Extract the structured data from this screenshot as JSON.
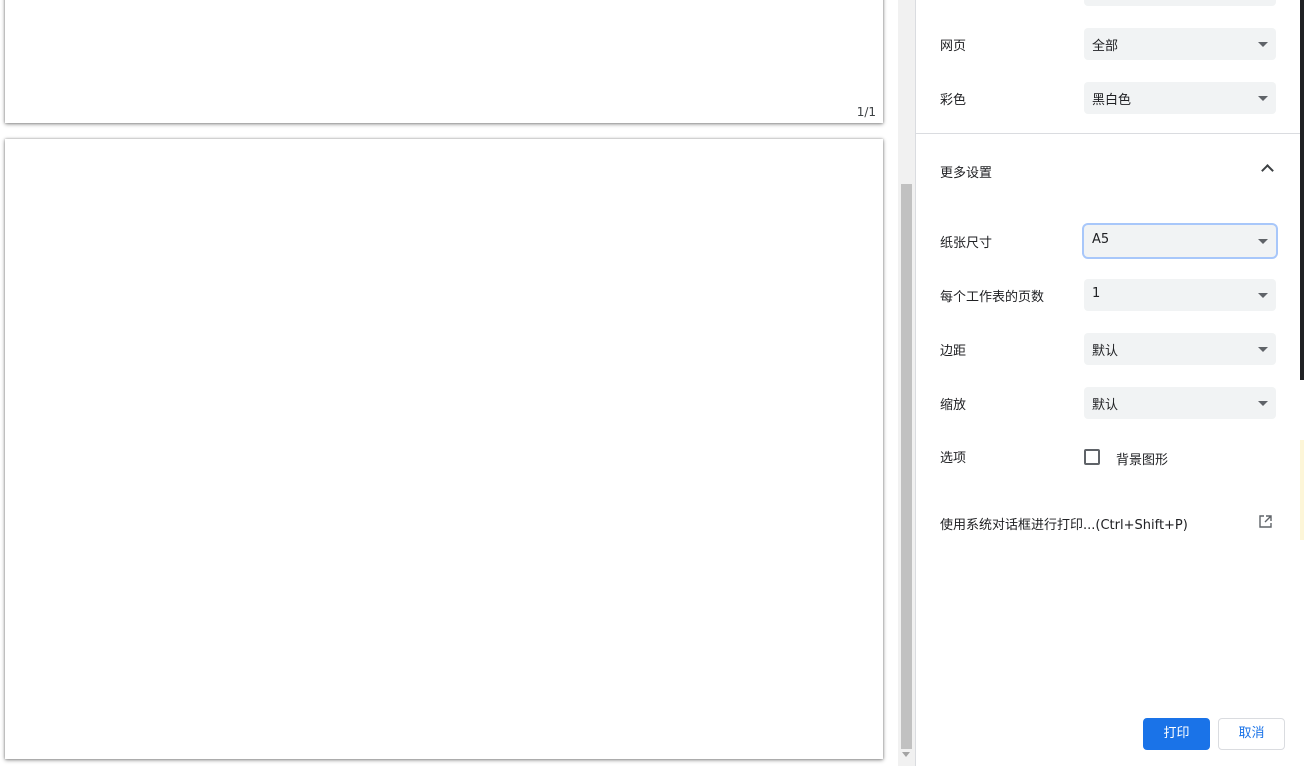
{
  "preview": {
    "page_counter": "1/1"
  },
  "settings": {
    "pages": {
      "label": "网页",
      "value": "全部"
    },
    "color": {
      "label": "彩色",
      "value": "黑白色"
    },
    "more_settings": {
      "label": "更多设置"
    },
    "paper_size": {
      "label": "纸张尺寸",
      "value": "A5"
    },
    "pages_per_sheet": {
      "label": "每个工作表的页数",
      "value": "1"
    },
    "margins": {
      "label": "边距",
      "value": "默认"
    },
    "scale": {
      "label": "缩放",
      "value": "默认"
    },
    "options": {
      "label": "选项",
      "background_graphics_label": "背景图形",
      "background_graphics_checked": false
    },
    "system_dialog": {
      "label": "使用系统对话框进行打印...(Ctrl+Shift+P)"
    }
  },
  "buttons": {
    "print_label": "打印",
    "cancel_label": "取消"
  },
  "colors": {
    "accent": "#1a73e8",
    "select_bg": "#f1f3f4",
    "focus_ring": "#a8c7fa"
  }
}
